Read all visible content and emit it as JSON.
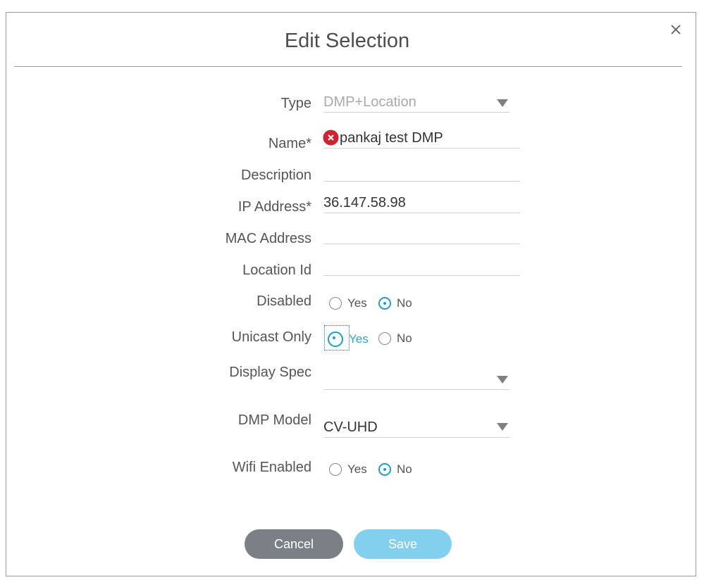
{
  "dialog": {
    "title": "Edit Selection",
    "close_icon": "close-icon"
  },
  "form": {
    "type": {
      "label": "Type",
      "value": "DMP+Location"
    },
    "name": {
      "label": "Name*",
      "value": "pankaj test DMP",
      "error_icon": "error-x-icon"
    },
    "description": {
      "label": "Description",
      "value": ""
    },
    "ip_address": {
      "label": "IP Address*",
      "value": "36.147.58.98"
    },
    "mac_address": {
      "label": "MAC Address",
      "value": ""
    },
    "location_id": {
      "label": "Location Id",
      "value": ""
    },
    "disabled": {
      "label": "Disabled",
      "yes": "Yes",
      "no": "No",
      "selected": "No"
    },
    "unicast_only": {
      "label": "Unicast Only",
      "yes": "Yes",
      "no": "No",
      "selected": "Yes"
    },
    "display_spec": {
      "label": "Display Spec",
      "value": ""
    },
    "dmp_model": {
      "label": "DMP Model",
      "value": "CV-UHD"
    },
    "wifi_enabled": {
      "label": "Wifi Enabled",
      "yes": "Yes",
      "no": "No",
      "selected": "No"
    }
  },
  "buttons": {
    "cancel": "Cancel",
    "save": "Save"
  },
  "colors": {
    "accent": "#1a9fd0",
    "cancel_bg": "#7b7f86",
    "save_bg": "#83d0ee",
    "error": "#d0222f"
  }
}
